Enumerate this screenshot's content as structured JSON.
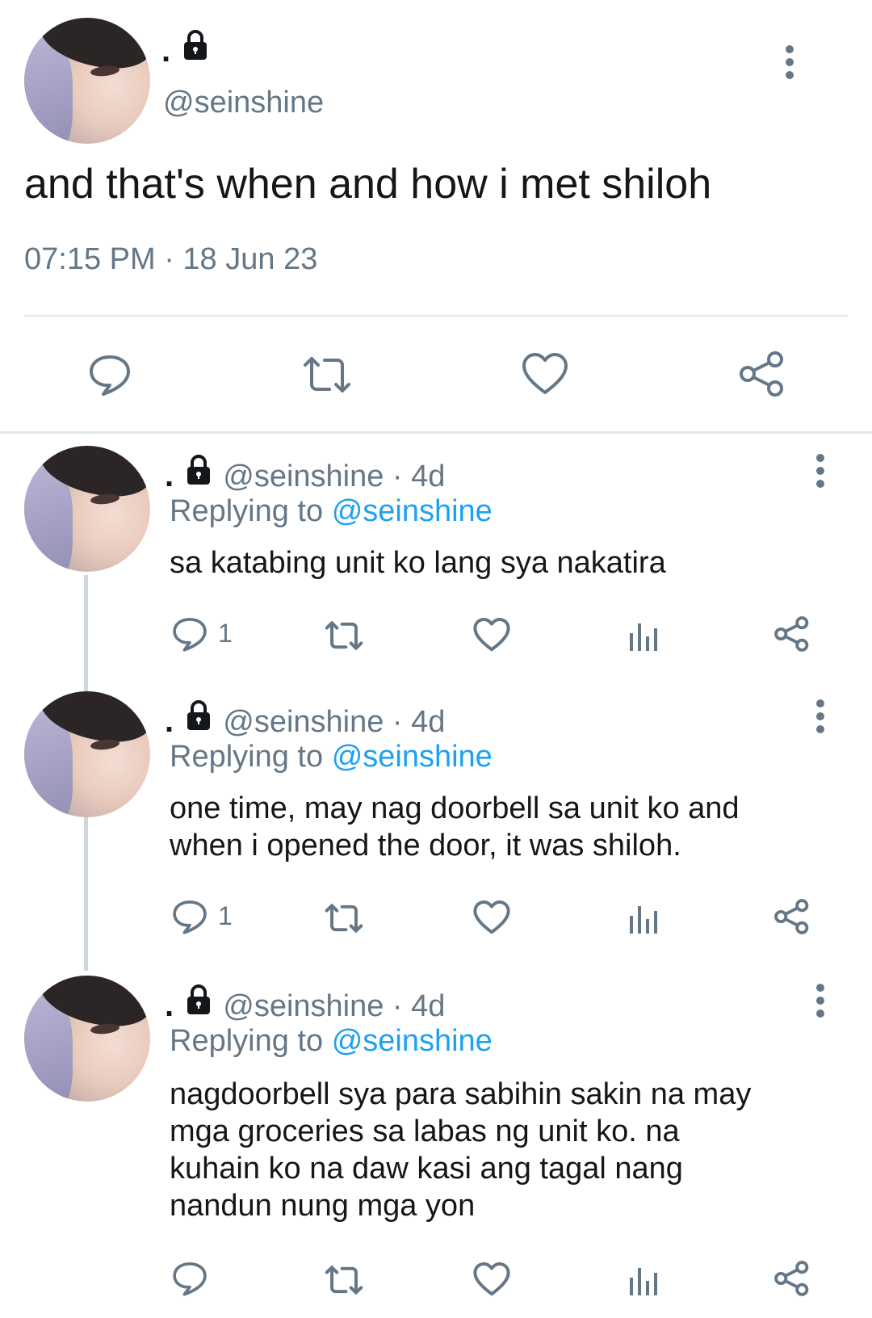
{
  "main_tweet": {
    "display_name": ".",
    "handle": "@seinshine",
    "text": "and that's when and how i met shiloh",
    "timestamp": "07:15 PM · 18 Jun 23",
    "actions": [
      "reply-icon",
      "retweet-icon",
      "like-icon",
      "share-icon"
    ]
  },
  "replies": [
    {
      "display_name": ".",
      "handle_time": "@seinshine · 4d",
      "replying_label": "Replying to",
      "replying_to": "@seinshine",
      "text": "sa katabing unit ko lang sya nakatira",
      "reply_count": "1"
    },
    {
      "display_name": ".",
      "handle_time": "@seinshine · 4d",
      "replying_label": "Replying to",
      "replying_to": "@seinshine",
      "text_lines": [
        "one time, may nag doorbell sa unit ko and",
        "when i opened the door, it was shiloh."
      ],
      "reply_count": "1"
    },
    {
      "display_name": ".",
      "handle_time": "@seinshine · 4d",
      "replying_label": "Replying to",
      "replying_to": "@seinshine",
      "text_lines": [
        "nagdoorbell sya para sabihin sakin na may",
        "mga groceries sa labas ng unit ko. na",
        "kuhain ko na daw kasi ang tagal nang",
        "nandun nung mga yon"
      ],
      "reply_count": ""
    }
  ],
  "colors": {
    "primary_text": "#14171a",
    "secondary_text": "#657786",
    "link": "#1da1f2",
    "divider": "#e1e8ed"
  }
}
